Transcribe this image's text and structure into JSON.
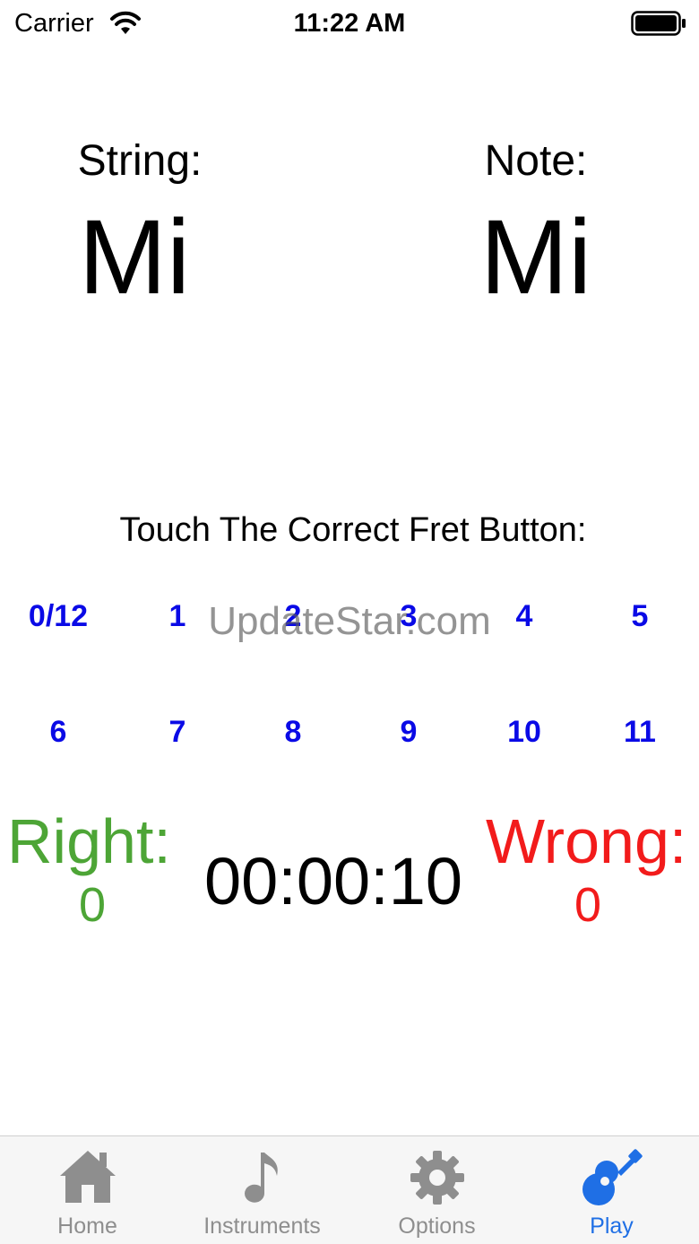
{
  "status_bar": {
    "carrier": "Carrier",
    "time": "11:22 AM"
  },
  "top": {
    "string_caption": "String:",
    "string_value": "Mi",
    "note_caption": "Note:",
    "note_value": "Mi"
  },
  "prompt": "Touch The Correct Fret Button:",
  "frets": [
    "0/12",
    "1",
    "2",
    "3",
    "4",
    "5",
    "6",
    "7",
    "8",
    "9",
    "10",
    "11"
  ],
  "fret_color": "#0a0ae6",
  "watermark": "UpdateStar.com",
  "score": {
    "right_label": "Right:",
    "right_count": "0",
    "right_color": "#4da536",
    "wrong_label": "Wrong:",
    "wrong_count": "0",
    "wrong_color": "#f21b1b",
    "timer": "00:00:10"
  },
  "tab_bar": {
    "tabs": [
      {
        "label": "Home",
        "icon": "home-icon",
        "active": false
      },
      {
        "label": "Instruments",
        "icon": "music-note-icon",
        "active": false
      },
      {
        "label": "Options",
        "icon": "gear-icon",
        "active": false
      },
      {
        "label": "Play",
        "icon": "guitar-icon",
        "active": true
      }
    ],
    "active_color": "#1f6fe5",
    "inactive_color": "#8e8e8e"
  }
}
